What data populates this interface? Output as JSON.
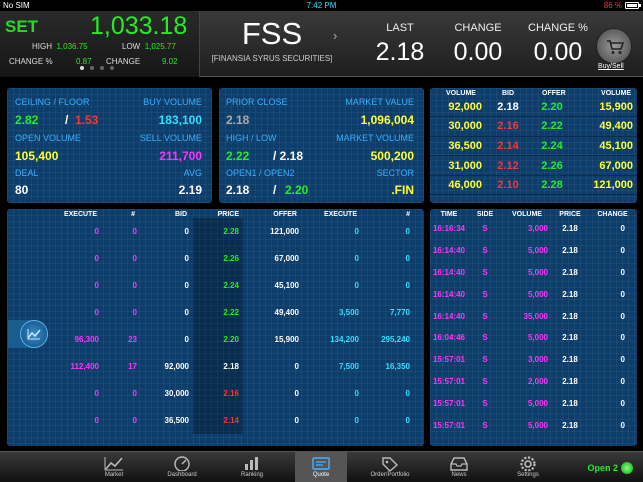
{
  "status": {
    "carrier": "No SIM",
    "time": "7:42 PM",
    "battery": "86 %"
  },
  "index": {
    "name": "SET",
    "value": "1,033.18",
    "high_label": "HIGH",
    "high": "1,036.75",
    "low_label": "LOW",
    "low": "1,025.77",
    "change_pct_label": "CHANGE %",
    "change_pct": "0.87",
    "change_label": "CHANGE",
    "change": "9.02"
  },
  "symbol": {
    "code": "FSS",
    "name": "[FINANSIA SYRUS SECURITIES]"
  },
  "quote": {
    "last_label": "LAST",
    "last": "2.18",
    "change_label": "CHANGE",
    "change": "0.00",
    "change_pct_label": "CHANGE %",
    "change_pct": "0.00"
  },
  "buysell_label": "Buy/Sell",
  "info": {
    "ceiling_floor_label": "CEILING / FLOOR",
    "ceiling": "2.82",
    "floor": "1.53",
    "floor_sep": "/",
    "buy_volume_label": "BUY VOLUME",
    "buy_volume": "183,100",
    "open_volume_label": "OPEN VOLUME",
    "open_volume": "105,400",
    "sell_volume_label": "SELL VOLUME",
    "sell_volume": "211,700",
    "deal_label": "DEAL",
    "deal": "80",
    "avg_label": "AVG",
    "avg": "2.19"
  },
  "info2": {
    "prior_close_label": "PRIOR CLOSE",
    "prior_close": "2.18",
    "market_value_label": "MARKET VALUE",
    "market_value": "1,096,004",
    "high_low_label": "HIGH / LOW",
    "high": "2.22",
    "low": "/ 2.18",
    "market_volume_label": "MARKET VOLUME",
    "market_volume": "500,200",
    "open_label": "OPEN1 / OPEN2",
    "open1": "2.18",
    "open2_sep": "/",
    "open2": "2.20",
    "sector_label": "SECTOR",
    "sector": ".FIN"
  },
  "bidoffer": {
    "headers": [
      "VOLUME",
      "BID",
      "OFFER",
      "VOLUME"
    ],
    "rows": [
      [
        "92,000",
        "2.18",
        "2.20",
        "15,900"
      ],
      [
        "30,000",
        "2.16",
        "2.22",
        "49,400"
      ],
      [
        "36,500",
        "2.14",
        "2.24",
        "45,100"
      ],
      [
        "31,000",
        "2.12",
        "2.26",
        "67,000"
      ],
      [
        "46,000",
        "2.10",
        "2.28",
        "121,000"
      ]
    ]
  },
  "execute": {
    "headers": [
      "EXECUTE",
      "#",
      "BID",
      "PRICE",
      "OFFER",
      "EXECUTE",
      "#"
    ],
    "rows": [
      [
        "0",
        "0",
        "0",
        "2.28",
        "121,000",
        "0",
        "0"
      ],
      [
        "0",
        "0",
        "0",
        "2.26",
        "67,000",
        "0",
        "0"
      ],
      [
        "0",
        "0",
        "0",
        "2.24",
        "45,100",
        "0",
        "0"
      ],
      [
        "0",
        "0",
        "0",
        "2.22",
        "49,400",
        "3,500",
        "7,770"
      ],
      [
        "96,300",
        "23",
        "0",
        "2.20",
        "15,900",
        "134,200",
        "295,240"
      ],
      [
        "112,400",
        "17",
        "92,000",
        "2.18",
        "0",
        "7,500",
        "16,350"
      ],
      [
        "0",
        "0",
        "30,000",
        "2.16",
        "0",
        "0",
        "0"
      ],
      [
        "0",
        "0",
        "36,500",
        "2.14",
        "0",
        "0",
        "0"
      ]
    ]
  },
  "ticks": {
    "headers": [
      "TIME",
      "SIDE",
      "VOLUME",
      "PRICE",
      "CHANGE"
    ],
    "rows": [
      [
        "16:16:34",
        "S",
        "3,000",
        "2.18",
        "0"
      ],
      [
        "16:14:40",
        "S",
        "5,000",
        "2.18",
        "0"
      ],
      [
        "16:14:40",
        "S",
        "5,000",
        "2.18",
        "0"
      ],
      [
        "16:14:40",
        "S",
        "5,000",
        "2.18",
        "0"
      ],
      [
        "16:14:40",
        "S",
        "35,000",
        "2.18",
        "0"
      ],
      [
        "16:04:46",
        "S",
        "5,000",
        "2.18",
        "0"
      ],
      [
        "15:57:01",
        "S",
        "3,000",
        "2.18",
        "0"
      ],
      [
        "15:57:01",
        "S",
        "2,000",
        "2.18",
        "0"
      ],
      [
        "15:57:01",
        "S",
        "5,000",
        "2.18",
        "0"
      ],
      [
        "15:57:01",
        "S",
        "5,000",
        "2.18",
        "0"
      ]
    ]
  },
  "tabs": [
    {
      "label": "Market",
      "icon": "market-chart-icon"
    },
    {
      "label": "Dashboard",
      "icon": "dashboard-gauge-icon"
    },
    {
      "label": "Ranking",
      "icon": "ranking-bars-icon"
    },
    {
      "label": "Quote",
      "icon": "quote-icon",
      "active": true
    },
    {
      "label": "Order/Portfolio",
      "icon": "tag-icon"
    },
    {
      "label": "News",
      "icon": "inbox-icon"
    },
    {
      "label": "Settings",
      "icon": "gear-icon"
    }
  ],
  "market_status": "Open 2"
}
